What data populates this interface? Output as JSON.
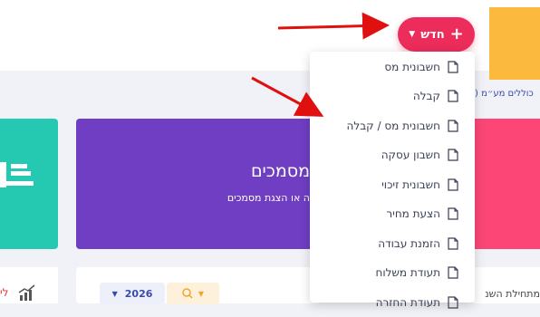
{
  "header": {
    "new_button_label": "חדש",
    "new_button_icon": "plus-icon",
    "dropdown_caret_icon": "chevron-down-icon"
  },
  "new_menu": {
    "items": [
      {
        "label": "חשבונית מס",
        "icon": "document-icon"
      },
      {
        "label": "קבלה",
        "icon": "document-icon"
      },
      {
        "label": "חשבונית מס / קבלה",
        "icon": "document-icon"
      },
      {
        "label": "חשבון עסקה",
        "icon": "document-icon"
      },
      {
        "label": "חשבונית זיכוי",
        "icon": "document-icon"
      },
      {
        "label": "הצעת מחיר",
        "icon": "document-icon"
      },
      {
        "label": "הזמנת עבודה",
        "icon": "document-icon"
      },
      {
        "label": "תעודת משלוח",
        "icon": "document-icon"
      },
      {
        "label": "תעודת החזרה",
        "icon": "document-icon"
      }
    ]
  },
  "summary_note": "כוללים מע״מ (",
  "documents_card": {
    "title": "מסמכים",
    "subtitle": "ה או הצגת מסמכים"
  },
  "filters": {
    "year": "2026"
  },
  "bottom_right_text": "מתחילת השנ",
  "bottom_left_text": "לי",
  "colors": {
    "accent_red": "#ec2c5b",
    "purple": "#6f3ec2",
    "teal": "#25c8b0",
    "pink": "#fb4676",
    "yellow": "#fbb93d",
    "arrow_red": "#e01010"
  }
}
